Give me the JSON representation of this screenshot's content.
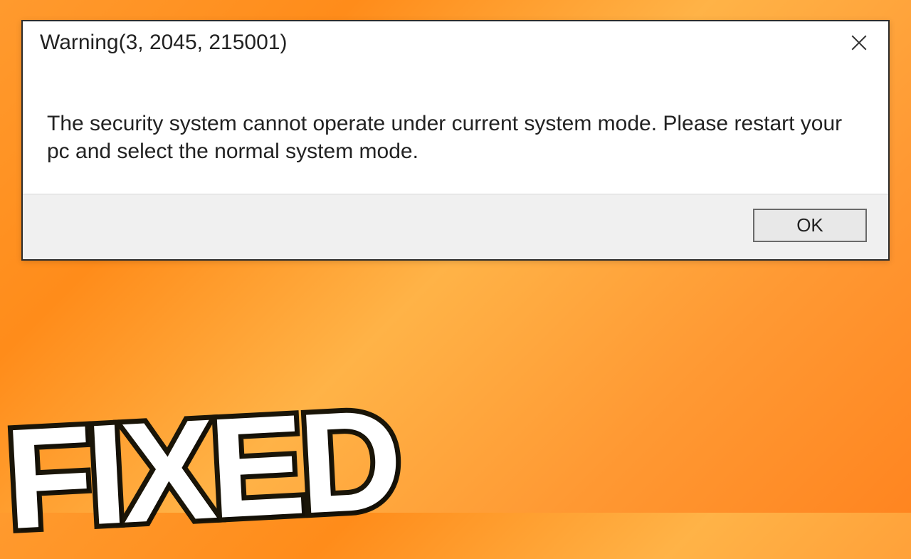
{
  "dialog": {
    "title": "Warning(3, 2045, 215001)",
    "message": "The security system cannot operate under current system mode. Please restart your pc and select the normal system mode.",
    "ok_label": "OK"
  },
  "overlay": {
    "text": "FIXED"
  }
}
